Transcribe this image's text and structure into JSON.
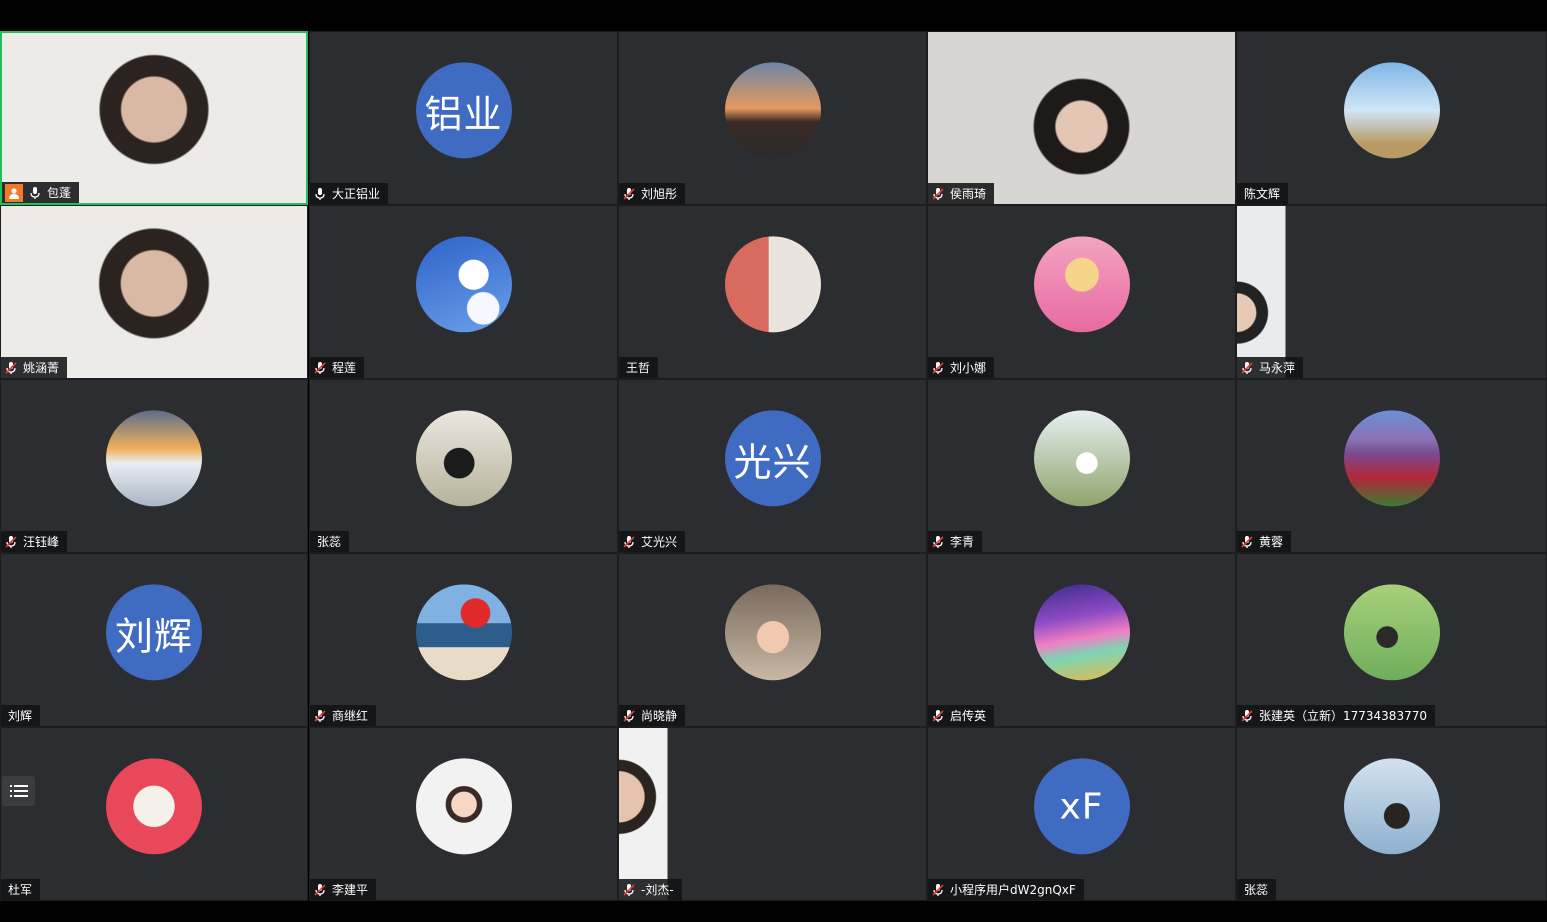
{
  "participants": [
    {
      "name": "包蓬",
      "mic": "on",
      "host": true,
      "active": true,
      "kind": "video",
      "icon": "woman-glasses-video"
    },
    {
      "name": "大正铝业",
      "mic": "on",
      "kind": "text",
      "avatar_text": "铝业"
    },
    {
      "name": "刘旭彤",
      "mic": "muted",
      "kind": "image",
      "icon": "sunset-photo"
    },
    {
      "name": "侯雨琦",
      "mic": "muted",
      "kind": "video",
      "icon": "woman-office-video"
    },
    {
      "name": "陈文辉",
      "mic": "none",
      "kind": "image",
      "icon": "eiffel-tower-photo"
    },
    {
      "name": "姚涵菁",
      "mic": "muted",
      "kind": "video",
      "icon": "woman-glasses-video"
    },
    {
      "name": "程莲",
      "mic": "muted",
      "kind": "image",
      "icon": "clouds-photo"
    },
    {
      "name": "王哲",
      "mic": "none",
      "kind": "image",
      "icon": "couple-photo"
    },
    {
      "name": "刘小娜",
      "mic": "muted",
      "kind": "image",
      "icon": "anime-girl-photo"
    },
    {
      "name": "马永萍",
      "mic": "muted",
      "kind": "portrait",
      "icon": "woman-portrait-video"
    },
    {
      "name": "汪钰峰",
      "mic": "muted",
      "kind": "image",
      "icon": "sunset-person-photo"
    },
    {
      "name": "张蕊",
      "mic": "none",
      "kind": "image",
      "icon": "girl-plant-photo"
    },
    {
      "name": "艾光兴",
      "mic": "muted",
      "kind": "text",
      "avatar_text": "光兴"
    },
    {
      "name": "李青",
      "mic": "muted",
      "kind": "image",
      "icon": "woman-flowers-photo"
    },
    {
      "name": "黄蓉",
      "mic": "muted",
      "kind": "image",
      "icon": "flower-field-photo"
    },
    {
      "name": "刘辉",
      "mic": "none",
      "kind": "text",
      "avatar_text": "刘辉"
    },
    {
      "name": "商继红",
      "mic": "muted",
      "kind": "image",
      "icon": "red-hat-sea-photo"
    },
    {
      "name": "尚晓静",
      "mic": "muted",
      "kind": "image",
      "icon": "baby-photo"
    },
    {
      "name": "启传英",
      "mic": "muted",
      "kind": "image",
      "icon": "rainbow-clouds-photo"
    },
    {
      "name": "张建英（立新）17734383770",
      "mic": "muted",
      "kind": "image",
      "icon": "girl-grass-photo"
    },
    {
      "name": "杜军",
      "mic": "none",
      "kind": "image",
      "icon": "illustration-woman-photo"
    },
    {
      "name": "李建平",
      "mic": "muted",
      "kind": "image",
      "icon": "cartoon-girl-photo"
    },
    {
      "name": "-刘杰-",
      "mic": "muted",
      "kind": "portrait",
      "icon": "woman-glasses-portrait-video"
    },
    {
      "name": "小程序用户dW2gnQxF",
      "mic": "muted",
      "kind": "text",
      "avatar_text": "xF"
    },
    {
      "name": "张蕊",
      "mic": "none",
      "kind": "image",
      "icon": "girl-seaside-photo"
    }
  ],
  "colors": {
    "tile_bg": "#2b2d30",
    "active_border": "#20c05c",
    "text_avatar_bg": "#3f6bc3",
    "host_badge": "#f07a2b",
    "muted_mic": "#e23b3b"
  },
  "list_button_icon": "list-icon"
}
